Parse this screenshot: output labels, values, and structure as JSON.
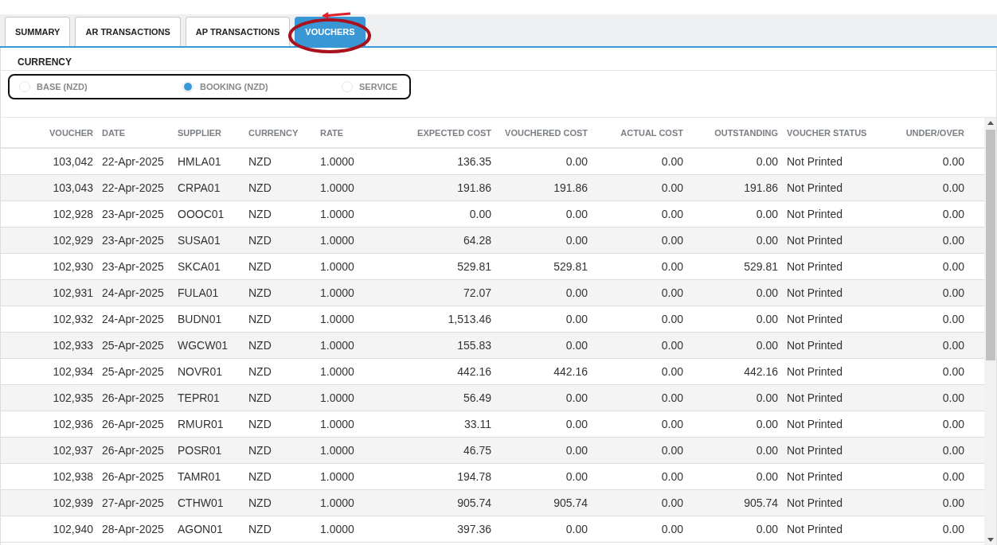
{
  "tabs": [
    {
      "label": "SUMMARY",
      "selected": false
    },
    {
      "label": "AR TRANSACTIONS",
      "selected": false
    },
    {
      "label": "AP TRANSACTIONS",
      "selected": false
    },
    {
      "label": "VOUCHERS",
      "selected": true
    }
  ],
  "currency": {
    "label": "CURRENCY",
    "options": [
      {
        "label": "BASE (NZD)",
        "selected": false
      },
      {
        "label": "BOOKING (NZD)",
        "selected": true
      },
      {
        "label": "SERVICE",
        "selected": false
      }
    ]
  },
  "table": {
    "columns": [
      "VOUCHER",
      "DATE",
      "SUPPLIER",
      "CURRENCY",
      "RATE",
      "EXPECTED COST",
      "VOUCHERED COST",
      "ACTUAL COST",
      "OUTSTANDING",
      "VOUCHER STATUS",
      "UNDER/OVER"
    ],
    "rows": [
      [
        "103,042",
        "22-Apr-2025",
        "HMLA01",
        "NZD",
        "1.0000",
        "136.35",
        "0.00",
        "0.00",
        "0.00",
        "Not Printed",
        "0.00"
      ],
      [
        "103,043",
        "22-Apr-2025",
        "CRPA01",
        "NZD",
        "1.0000",
        "191.86",
        "191.86",
        "0.00",
        "191.86",
        "Not Printed",
        "0.00"
      ],
      [
        "102,928",
        "23-Apr-2025",
        "OOOC01",
        "NZD",
        "1.0000",
        "0.00",
        "0.00",
        "0.00",
        "0.00",
        "Not Printed",
        "0.00"
      ],
      [
        "102,929",
        "23-Apr-2025",
        "SUSA01",
        "NZD",
        "1.0000",
        "64.28",
        "0.00",
        "0.00",
        "0.00",
        "Not Printed",
        "0.00"
      ],
      [
        "102,930",
        "23-Apr-2025",
        "SKCA01",
        "NZD",
        "1.0000",
        "529.81",
        "529.81",
        "0.00",
        "529.81",
        "Not Printed",
        "0.00"
      ],
      [
        "102,931",
        "24-Apr-2025",
        "FULA01",
        "NZD",
        "1.0000",
        "72.07",
        "0.00",
        "0.00",
        "0.00",
        "Not Printed",
        "0.00"
      ],
      [
        "102,932",
        "24-Apr-2025",
        "BUDN01",
        "NZD",
        "1.0000",
        "1,513.46",
        "0.00",
        "0.00",
        "0.00",
        "Not Printed",
        "0.00"
      ],
      [
        "102,933",
        "25-Apr-2025",
        "WGCW01",
        "NZD",
        "1.0000",
        "155.83",
        "0.00",
        "0.00",
        "0.00",
        "Not Printed",
        "0.00"
      ],
      [
        "102,934",
        "25-Apr-2025",
        "NOVR01",
        "NZD",
        "1.0000",
        "442.16",
        "442.16",
        "0.00",
        "442.16",
        "Not Printed",
        "0.00"
      ],
      [
        "102,935",
        "26-Apr-2025",
        "TEPR01",
        "NZD",
        "1.0000",
        "56.49",
        "0.00",
        "0.00",
        "0.00",
        "Not Printed",
        "0.00"
      ],
      [
        "102,936",
        "26-Apr-2025",
        "RMUR01",
        "NZD",
        "1.0000",
        "33.11",
        "0.00",
        "0.00",
        "0.00",
        "Not Printed",
        "0.00"
      ],
      [
        "102,937",
        "26-Apr-2025",
        "POSR01",
        "NZD",
        "1.0000",
        "46.75",
        "0.00",
        "0.00",
        "0.00",
        "Not Printed",
        "0.00"
      ],
      [
        "102,938",
        "26-Apr-2025",
        "TAMR01",
        "NZD",
        "1.0000",
        "194.78",
        "0.00",
        "0.00",
        "0.00",
        "Not Printed",
        "0.00"
      ],
      [
        "102,939",
        "27-Apr-2025",
        "CTHW01",
        "NZD",
        "1.0000",
        "905.74",
        "905.74",
        "0.00",
        "905.74",
        "Not Printed",
        "0.00"
      ],
      [
        "102,940",
        "28-Apr-2025",
        "AGON01",
        "NZD",
        "1.0000",
        "397.36",
        "0.00",
        "0.00",
        "0.00",
        "Not Printed",
        "0.00"
      ]
    ]
  }
}
